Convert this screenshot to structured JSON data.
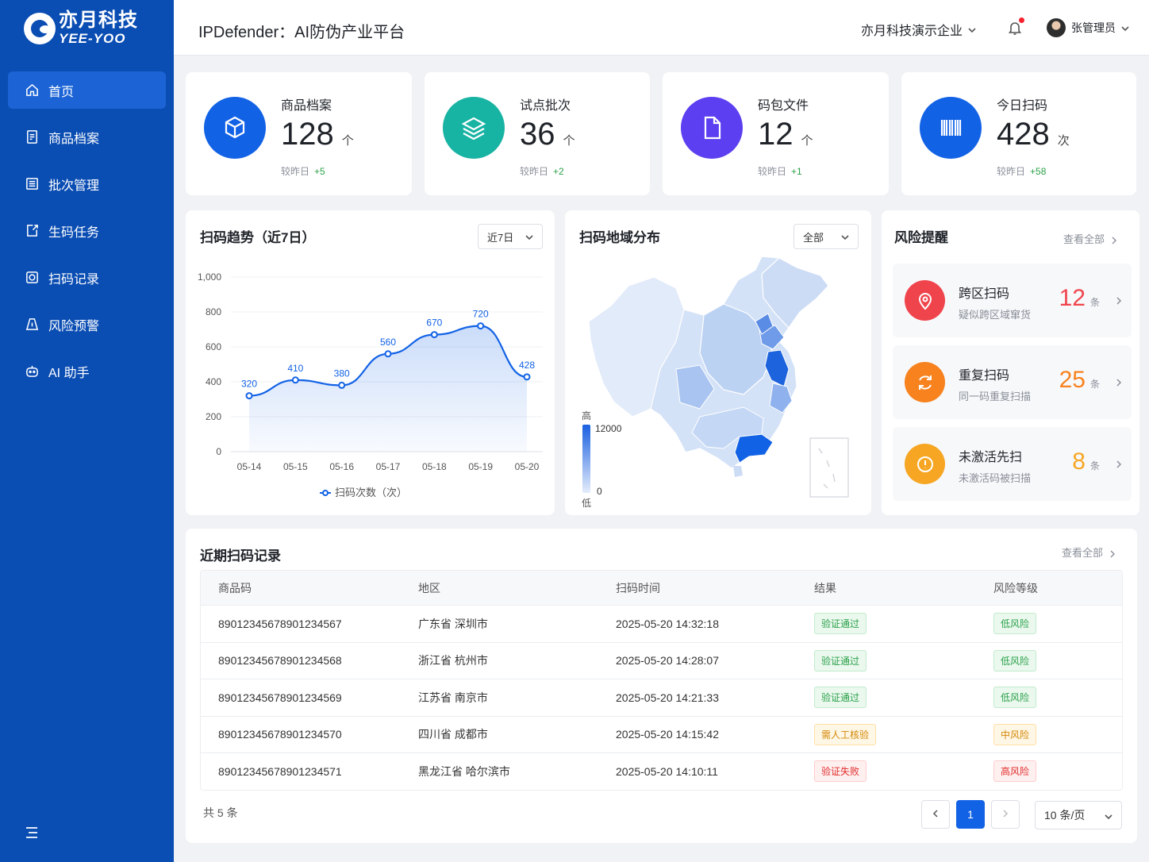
{
  "brand": {
    "name_cn": "亦月科技",
    "name_en": "YEE-YOO"
  },
  "sidebar": {
    "items": [
      {
        "label": "首页",
        "icon": "home-icon",
        "active": true
      },
      {
        "label": "商品档案",
        "icon": "product-file-icon"
      },
      {
        "label": "批次管理",
        "icon": "batch-icon"
      },
      {
        "label": "生码任务",
        "icon": "code-task-icon"
      },
      {
        "label": "扫码记录",
        "icon": "scan-record-icon"
      },
      {
        "label": "风险预警",
        "icon": "warning-icon"
      },
      {
        "label": "AI 助手",
        "icon": "robot-icon"
      }
    ]
  },
  "header": {
    "title": "IPDefender：AI防伪产业平台",
    "org": "亦月科技演示企业",
    "user": "张管理员"
  },
  "stats": [
    {
      "title": "商品档案",
      "value": "128",
      "unit": "个",
      "compare_label": "较昨日",
      "delta": "+5",
      "color": "#1262e6",
      "icon": "cube-icon"
    },
    {
      "title": "试点批次",
      "value": "36",
      "unit": "个",
      "compare_label": "较昨日",
      "delta": "+2",
      "color": "#17b3a3",
      "icon": "layers-icon"
    },
    {
      "title": "码包文件",
      "value": "12",
      "unit": "个",
      "compare_label": "较昨日",
      "delta": "+1",
      "color": "#5b3ff0",
      "icon": "document-icon"
    },
    {
      "title": "今日扫码",
      "value": "428",
      "unit": "次",
      "compare_label": "较昨日",
      "delta": "+58",
      "color": "#1262e6",
      "icon": "barcode-icon"
    }
  ],
  "trend": {
    "title": "扫码趋势（近7日）",
    "range": "近7日"
  },
  "chart_data": {
    "type": "area",
    "categories": [
      "05-14",
      "05-15",
      "05-16",
      "05-17",
      "05-18",
      "05-19",
      "05-20"
    ],
    "series": [
      {
        "name": "扫码次数（次）",
        "values": [
          320,
          410,
          380,
          560,
          670,
          720,
          428
        ]
      }
    ],
    "ylim": [
      0,
      1000
    ],
    "yticks": [
      "1,000",
      "800",
      "600",
      "400",
      "200",
      "0"
    ],
    "grid": true,
    "legend": "bottom",
    "color": "#1262e6"
  },
  "map": {
    "title": "扫码地域分布",
    "filter": "全部",
    "legend_high": "高",
    "legend_low": "低",
    "max": "12000",
    "min": "0"
  },
  "risk": {
    "title": "风险提醒",
    "view_all": "查看全部",
    "items": [
      {
        "title": "跨区扫码",
        "sub": "疑似跨区域窜货",
        "count": "12",
        "unit": "条",
        "color": "#f0444c",
        "icon": "location-alert-icon"
      },
      {
        "title": "重复扫码",
        "sub": "同一码重复扫描",
        "count": "25",
        "unit": "条",
        "color": "#f7821e",
        "icon": "refresh-icon"
      },
      {
        "title": "未激活先扫",
        "sub": "未激活码被扫描",
        "count": "8",
        "unit": "条",
        "color": "#f6a623",
        "icon": "alert-circle-icon"
      }
    ]
  },
  "records": {
    "title": "近期扫码记录",
    "view_all": "查看全部",
    "columns": [
      "商品码",
      "地区",
      "扫码时间",
      "结果",
      "风险等级"
    ],
    "rows": [
      {
        "code": "89012345678901234567",
        "region": "广东省 深圳市",
        "time": "2025-05-20 14:32:18",
        "result": "验证通过",
        "risk": "低风险",
        "result_tone": "green",
        "risk_tone": "green"
      },
      {
        "code": "89012345678901234568",
        "region": "浙江省 杭州市",
        "time": "2025-05-20 14:28:07",
        "result": "验证通过",
        "risk": "低风险",
        "result_tone": "green",
        "risk_tone": "green"
      },
      {
        "code": "89012345678901234569",
        "region": "江苏省 南京市",
        "time": "2025-05-20 14:21:33",
        "result": "验证通过",
        "risk": "低风险",
        "result_tone": "green",
        "risk_tone": "green"
      },
      {
        "code": "89012345678901234570",
        "region": "四川省 成都市",
        "time": "2025-05-20 14:15:42",
        "result": "需人工核验",
        "risk": "中风险",
        "result_tone": "orange",
        "risk_tone": "orange"
      },
      {
        "code": "89012345678901234571",
        "region": "黑龙江省 哈尔滨市",
        "time": "2025-05-20 14:10:11",
        "result": "验证失败",
        "risk": "高风险",
        "result_tone": "red",
        "risk_tone": "red"
      }
    ],
    "total": "共 5 条",
    "page": "1",
    "page_size": "10 条/页"
  }
}
